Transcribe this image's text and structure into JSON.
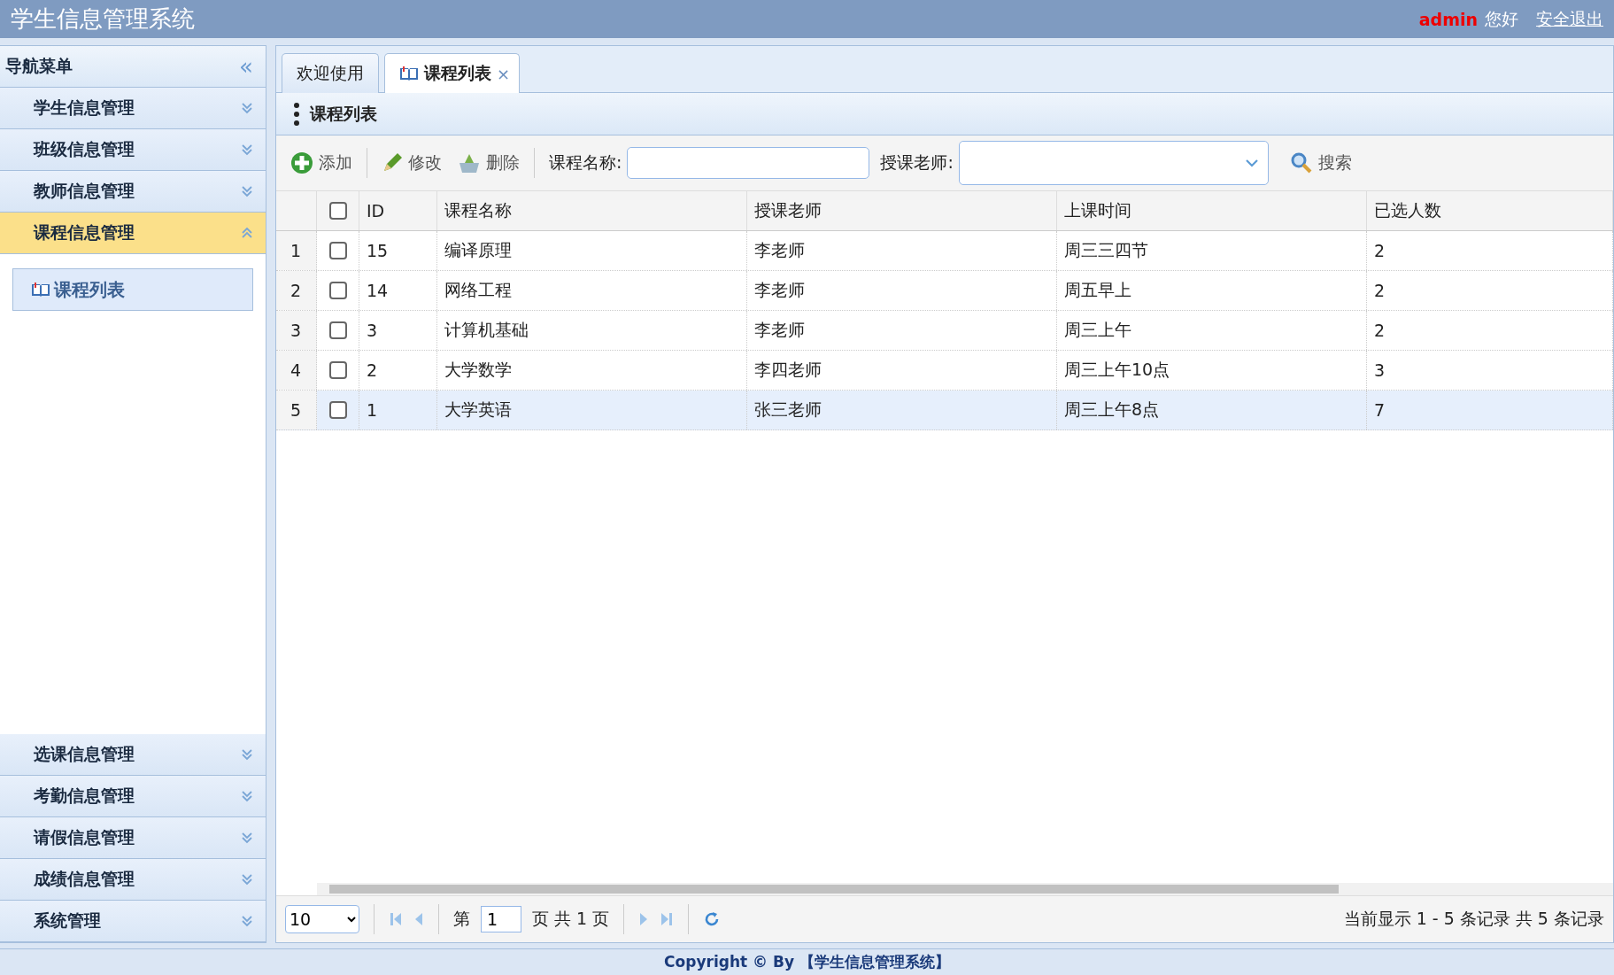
{
  "header": {
    "title": "学生信息管理系统",
    "user": "admin",
    "greeting": "您好",
    "logout": "安全退出"
  },
  "sidebar": {
    "title": "导航菜单",
    "collapse_icon": "«",
    "groups": [
      {
        "label": "学生信息管理",
        "expanded": false
      },
      {
        "label": "班级信息管理",
        "expanded": false
      },
      {
        "label": "教师信息管理",
        "expanded": false
      },
      {
        "label": "课程信息管理",
        "expanded": true,
        "children": [
          {
            "label": "课程列表"
          }
        ]
      },
      {
        "label": "选课信息管理",
        "expanded": false
      },
      {
        "label": "考勤信息管理",
        "expanded": false
      },
      {
        "label": "请假信息管理",
        "expanded": false
      },
      {
        "label": "成绩信息管理",
        "expanded": false
      },
      {
        "label": "系统管理",
        "expanded": false
      }
    ]
  },
  "tabs": [
    {
      "label": "欢迎使用",
      "selected": false,
      "icon": false,
      "closable": false
    },
    {
      "label": "课程列表",
      "selected": true,
      "icon": true,
      "closable": true,
      "close": "×"
    }
  ],
  "panel": {
    "title": "课程列表"
  },
  "toolbar": {
    "buttons": [
      {
        "kind": "add",
        "label": "添加"
      },
      {
        "kind": "edit",
        "label": "修改"
      },
      {
        "kind": "delete",
        "label": "删除"
      }
    ],
    "name_label": "课程名称:",
    "teacher_label": "授课老师:",
    "search": "搜索"
  },
  "table": {
    "columns": [
      "ID",
      "课程名称",
      "授课老师",
      "上课时间",
      "已选人数"
    ],
    "header_checked": false,
    "rows": [
      {
        "num": "1",
        "checked": false,
        "hover": false,
        "cells": [
          "15",
          "编译原理",
          "李老师",
          "周三三四节",
          "2"
        ]
      },
      {
        "num": "2",
        "checked": false,
        "hover": false,
        "cells": [
          "14",
          "网络工程",
          "李老师",
          "周五早上",
          "2"
        ]
      },
      {
        "num": "3",
        "checked": false,
        "hover": false,
        "cells": [
          "3",
          "计算机基础",
          "李老师",
          "周三上午",
          "2"
        ]
      },
      {
        "num": "4",
        "checked": false,
        "hover": false,
        "cells": [
          "2",
          "大学数学",
          "李四老师",
          "周三上午10点",
          "3"
        ]
      },
      {
        "num": "5",
        "checked": false,
        "hover": true,
        "cells": [
          "1",
          "大学英语",
          "张三老师",
          "周三上午8点",
          "7"
        ]
      }
    ]
  },
  "pager": {
    "page_size": "10",
    "page_prefix": "第",
    "page": "1",
    "page_suffix": "页 共 1 页",
    "info": "当前显示 1 - 5 条记录 共 5 条记录"
  },
  "footer": "Copyright © By 【学生信息管理系统】"
}
